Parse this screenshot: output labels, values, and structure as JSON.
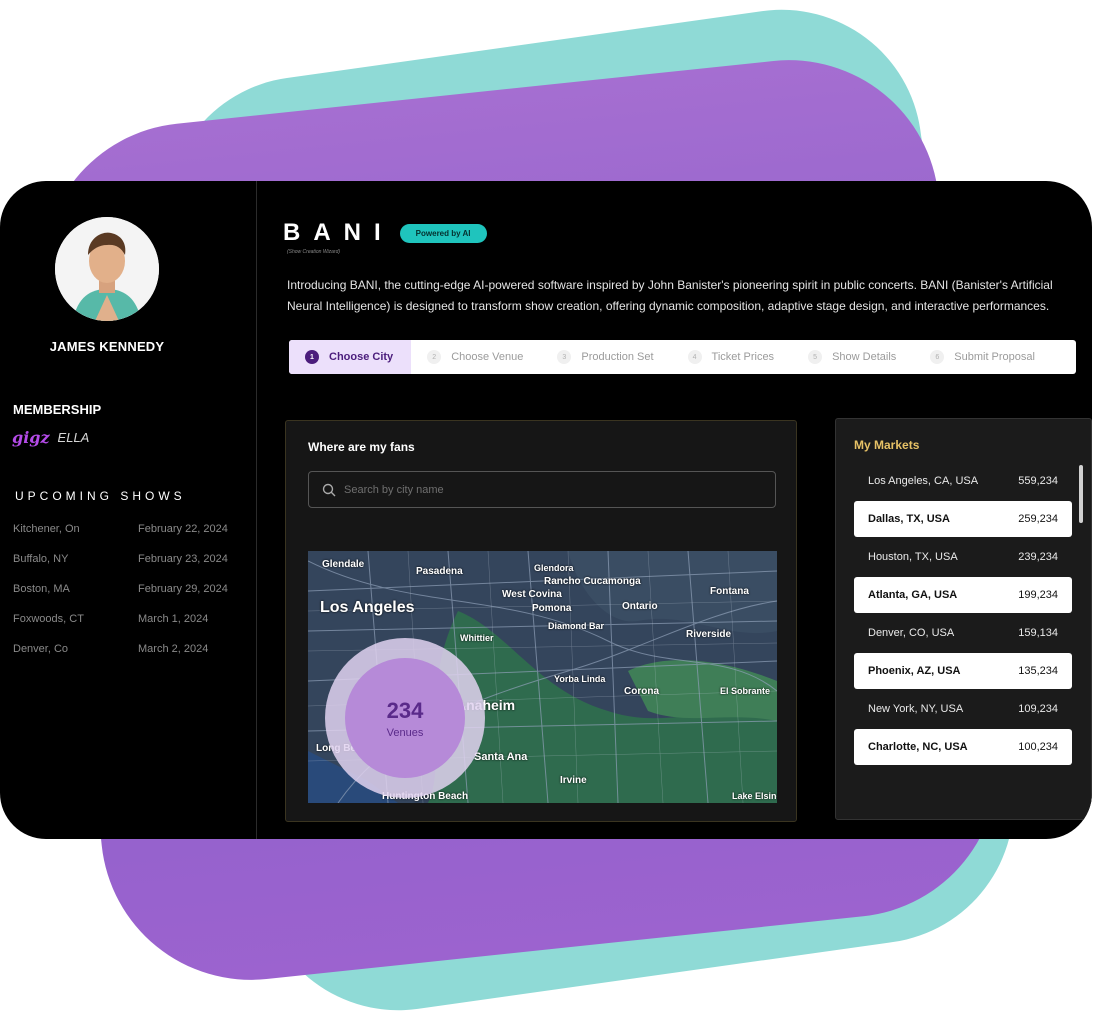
{
  "profile": {
    "name": "JAMES KENNEDY",
    "membership_title": "MEMBERSHIP",
    "membership_logo": "gigz",
    "membership_name": "ELLA"
  },
  "upcoming": {
    "title": "UPCOMING SHOWS",
    "shows": [
      {
        "city": "Kitchener, On",
        "date": "February 22, 2024"
      },
      {
        "city": "Buffalo, NY",
        "date": "February 23, 2024"
      },
      {
        "city": "Boston, MA",
        "date": "February 29, 2024"
      },
      {
        "city": "Foxwoods, CT",
        "date": "March 1, 2024"
      },
      {
        "city": "Denver, Co",
        "date": "March 2, 2024"
      }
    ]
  },
  "header": {
    "logo": "BANI",
    "badge": "Powered by AI",
    "subtitle": "(Show Creation Wizard)",
    "intro": "Introducing BANI, the cutting-edge AI-powered software inspired by John Banister's pioneering spirit in public concerts. BANI (Banister's Artificial Neural Intelligence) is designed to transform show creation, offering dynamic composition, adaptive stage design, and interactive performances."
  },
  "steps": [
    {
      "num": "1",
      "label": "Choose City",
      "active": true
    },
    {
      "num": "2",
      "label": "Choose Venue"
    },
    {
      "num": "3",
      "label": "Production Set"
    },
    {
      "num": "4",
      "label": "Ticket Prices"
    },
    {
      "num": "5",
      "label": "Show Details"
    },
    {
      "num": "6",
      "label": "Submit Proposal"
    }
  ],
  "fans": {
    "title": "Where are my fans",
    "search_placeholder": "Search by city name",
    "venue_count": "234",
    "venue_label": "Venues",
    "map_labels": {
      "glendale": "Glendale",
      "pasadena": "Pasadena",
      "glendora": "Glendora",
      "rancho": "Rancho Cucamonga",
      "fontana": "Fontana",
      "west_covina": "West Covina",
      "pomona": "Pomona",
      "ontario": "Ontario",
      "los_angeles": "Los Angeles",
      "diamond_bar": "Diamond Bar",
      "whittier": "Whittier",
      "riverside": "Riverside",
      "yorba_linda": "Yorba Linda",
      "corona": "Corona",
      "el_sobrante": "El Sobrante",
      "anaheim": "Anaheim",
      "long_beach": "Long Beach",
      "santa_ana": "Santa Ana",
      "irvine": "Irvine",
      "huntington_beach": "Huntington Beach",
      "lake_elsinore": "Lake Elsino"
    }
  },
  "markets": {
    "title": "My Markets",
    "items": [
      {
        "city": "Los Angeles, CA, USA",
        "value": "559,234",
        "highlight": false
      },
      {
        "city": "Dallas, TX, USA",
        "value": "259,234",
        "highlight": true
      },
      {
        "city": "Houston, TX, USA",
        "value": "239,234",
        "highlight": false
      },
      {
        "city": "Atlanta, GA, USA",
        "value": "199,234",
        "highlight": true
      },
      {
        "city": "Denver, CO, USA",
        "value": "159,134",
        "highlight": false
      },
      {
        "city": "Phoenix, AZ, USA",
        "value": "135,234",
        "highlight": true
      },
      {
        "city": "New York, NY, USA",
        "value": "109,234",
        "highlight": false
      },
      {
        "city": "Charlotte, NC, USA",
        "value": "100,234",
        "highlight": true
      }
    ]
  },
  "colors": {
    "accent_purple": "#4b1d7c",
    "badge_teal": "#1fc4bd",
    "markets_gold": "#e7c266"
  }
}
